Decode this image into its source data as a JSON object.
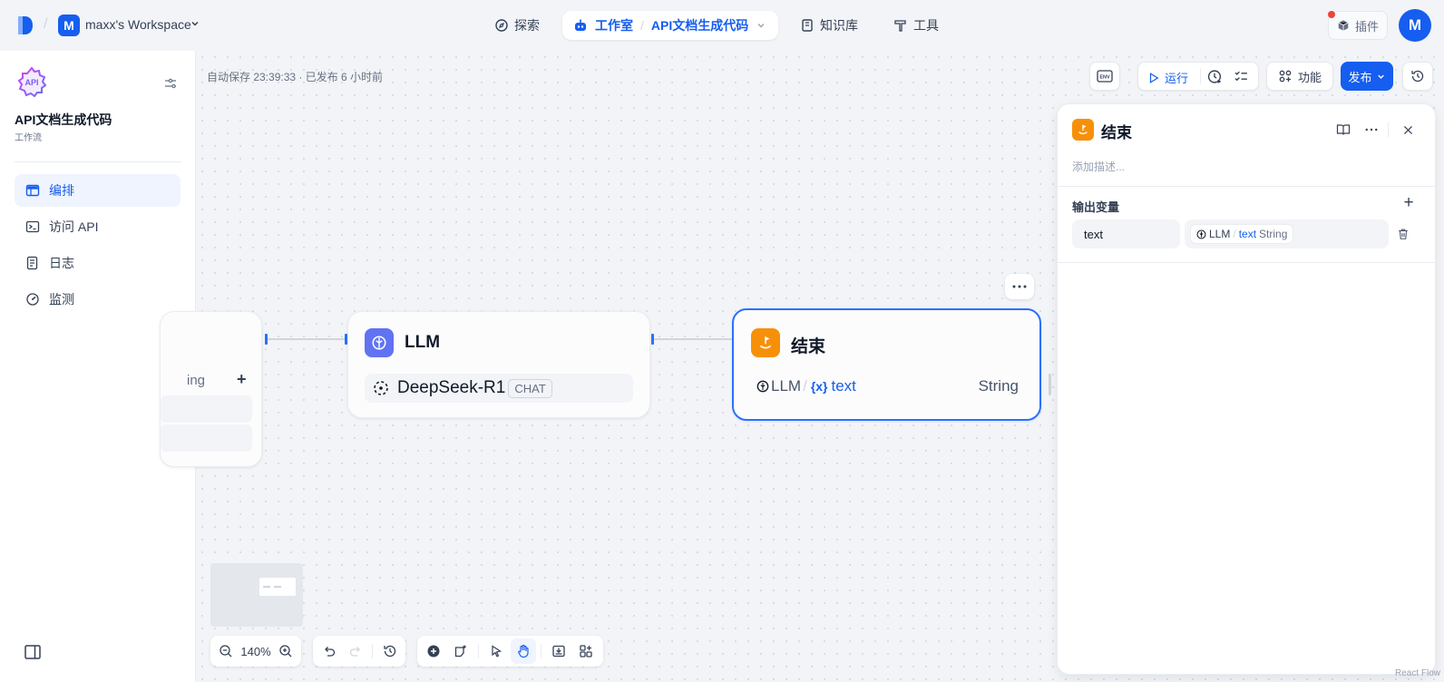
{
  "topbar": {
    "workspace_initial": "M",
    "workspace_name": "maxx's Workspace",
    "nav": {
      "explore": "探索",
      "studio": "工作室",
      "app_name": "API文档生成代码",
      "knowledge": "知识库",
      "tools": "工具"
    },
    "plugin_label": "插件",
    "user_initial": "M"
  },
  "sidebar": {
    "app_title": "API文档生成代码",
    "app_type": "工作流",
    "app_icon_text": "API",
    "items": [
      {
        "label": "编排",
        "icon": "layout-icon"
      },
      {
        "label": "访问 API",
        "icon": "terminal-icon"
      },
      {
        "label": "日志",
        "icon": "file-list-icon"
      },
      {
        "label": "监测",
        "icon": "gauge-icon"
      }
    ]
  },
  "canvas": {
    "autosave_text": "自动保存 23:39:33 · 已发布 6 小时前",
    "env_label": "ENV",
    "run_label": "运行",
    "features_label": "功能",
    "publish_label": "发布",
    "start_node": {
      "partial_text": "ing",
      "add_symbol": "+"
    },
    "llm_node": {
      "title": "LLM",
      "model": "DeepSeek-R1",
      "model_badge": "CHAT"
    },
    "end_node": {
      "title": "结束",
      "source_node": "LLM",
      "separator": "/",
      "var_symbol": "{x}",
      "var_name": "text",
      "var_type": "String"
    },
    "zoom_label": "140%"
  },
  "panel": {
    "title": "结束",
    "description_placeholder": "添加描述...",
    "output_heading": "输出变量",
    "add_symbol": "+",
    "output_var": {
      "name": "text",
      "source": "LLM",
      "separator": "/",
      "field": "text",
      "type": "String"
    }
  },
  "colors": {
    "primary": "#155eef",
    "end_node_accent": "#f79009",
    "llm_node_accent": "#6172f3",
    "selection_border": "#2970ff"
  },
  "watermark": "React Flow"
}
